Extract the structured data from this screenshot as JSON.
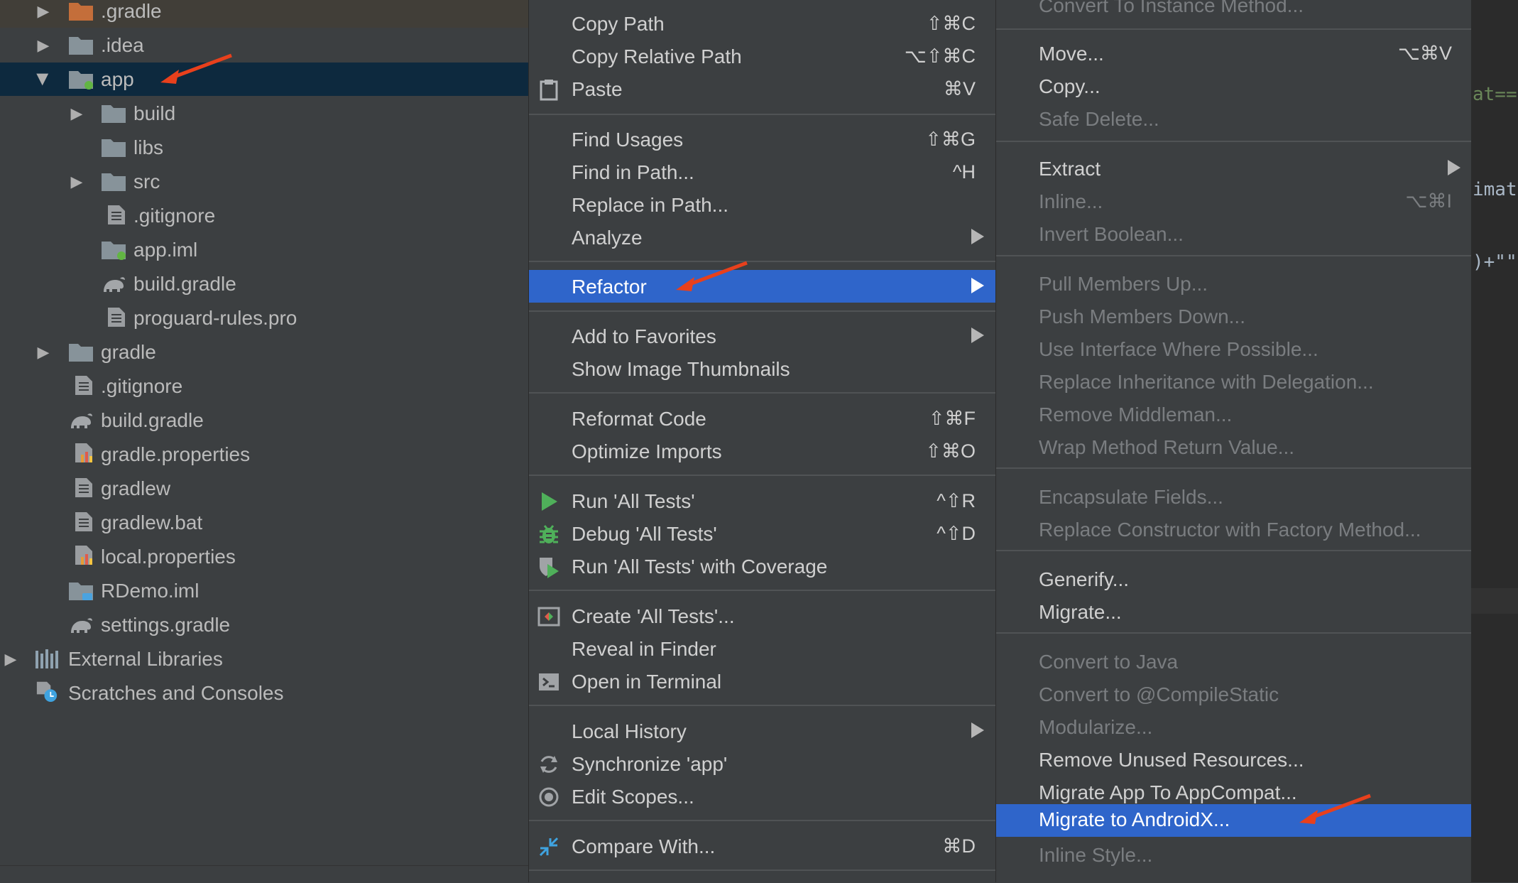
{
  "tree": {
    "items": [
      {
        "label": ".gradle",
        "icon": "folder-orange-icon",
        "arrow": "collapsed-arrow-icon"
      },
      {
        "label": ".idea",
        "icon": "folder-icon",
        "arrow": "collapsed-arrow-icon"
      },
      {
        "label": "app",
        "icon": "module-folder-icon",
        "arrow": "expanded-arrow-icon",
        "selected": true
      },
      {
        "label": "build",
        "icon": "folder-icon",
        "arrow": "collapsed-arrow-icon"
      },
      {
        "label": "libs",
        "icon": "folder-icon"
      },
      {
        "label": "src",
        "icon": "folder-icon",
        "arrow": "collapsed-arrow-icon"
      },
      {
        "label": ".gitignore",
        "icon": "text-file-icon"
      },
      {
        "label": "app.iml",
        "icon": "module-file-icon"
      },
      {
        "label": "build.gradle",
        "icon": "gradle-elephant-icon"
      },
      {
        "label": "proguard-rules.pro",
        "icon": "text-file-icon"
      },
      {
        "label": "gradle",
        "icon": "folder-icon",
        "arrow": "collapsed-arrow-icon"
      },
      {
        "label": ".gitignore",
        "icon": "text-file-icon"
      },
      {
        "label": "build.gradle",
        "icon": "gradle-elephant-icon"
      },
      {
        "label": "gradle.properties",
        "icon": "properties-file-icon"
      },
      {
        "label": "gradlew",
        "icon": "text-file-icon"
      },
      {
        "label": "gradlew.bat",
        "icon": "text-file-icon"
      },
      {
        "label": "local.properties",
        "icon": "properties-file-icon"
      },
      {
        "label": "RDemo.iml",
        "icon": "iml-module-icon"
      },
      {
        "label": "settings.gradle",
        "icon": "gradle-elephant-icon"
      },
      {
        "label": "External Libraries",
        "icon": "libraries-icon",
        "arrow": "collapsed-arrow-icon"
      },
      {
        "label": "Scratches and Consoles",
        "icon": "scratches-icon"
      }
    ]
  },
  "context_menu": {
    "items": [
      {
        "label": "Copy Path",
        "shortcut": "⇧⌘C"
      },
      {
        "label": "Copy Relative Path",
        "shortcut": "⌥⇧⌘C"
      },
      {
        "label": "Paste",
        "shortcut": "⌘V",
        "icon": "clipboard-icon"
      },
      {
        "label": "Find Usages",
        "shortcut": "⇧⌘G"
      },
      {
        "label": "Find in Path...",
        "shortcut": "^H"
      },
      {
        "label": "Replace in Path...",
        "shortcut": ""
      },
      {
        "label": "Analyze",
        "submenu": true
      },
      {
        "label": "Refactor",
        "submenu": true,
        "selected": true
      },
      {
        "label": "Add to Favorites",
        "submenu": true
      },
      {
        "label": "Show Image Thumbnails",
        "shortcut": ""
      },
      {
        "label": "Reformat Code",
        "shortcut": "⇧⌘F"
      },
      {
        "label": "Optimize Imports",
        "shortcut": "⇧⌘O"
      },
      {
        "label": "Run 'All Tests'",
        "shortcut": "^⇧R",
        "icon": "run-icon"
      },
      {
        "label": "Debug 'All Tests'",
        "shortcut": "^⇧D",
        "icon": "debug-bug-icon"
      },
      {
        "label": "Run 'All Tests' with Coverage",
        "shortcut": "",
        "icon": "coverage-icon"
      },
      {
        "label": "Create 'All Tests'...",
        "shortcut": "",
        "icon": "create-test-icon"
      },
      {
        "label": "Reveal in Finder",
        "shortcut": ""
      },
      {
        "label": "Open in Terminal",
        "shortcut": "",
        "icon": "terminal-icon"
      },
      {
        "label": "Local History",
        "submenu": true
      },
      {
        "label": "Synchronize 'app'",
        "shortcut": "",
        "icon": "synchronize-icon"
      },
      {
        "label": "Edit Scopes...",
        "shortcut": "",
        "icon": "scopes-icon"
      },
      {
        "label": "Compare With...",
        "shortcut": "⌘D",
        "icon": "compare-icon"
      }
    ]
  },
  "refactor_menu": {
    "items": [
      {
        "label": "Convert To Instance Method...",
        "disabled": true
      },
      {
        "label": "Move...",
        "shortcut": "⌥⌘V"
      },
      {
        "label": "Copy..."
      },
      {
        "label": "Safe Delete...",
        "disabled": true
      },
      {
        "label": "Extract",
        "submenu": true
      },
      {
        "label": "Inline...",
        "shortcut": "⌥⌘I",
        "disabled": true
      },
      {
        "label": "Invert Boolean...",
        "disabled": true
      },
      {
        "label": "Pull Members Up...",
        "disabled": true
      },
      {
        "label": "Push Members Down...",
        "disabled": true
      },
      {
        "label": "Use Interface Where Possible...",
        "disabled": true
      },
      {
        "label": "Replace Inheritance with Delegation...",
        "disabled": true
      },
      {
        "label": "Remove Middleman...",
        "disabled": true
      },
      {
        "label": "Wrap Method Return Value...",
        "disabled": true
      },
      {
        "label": "Encapsulate Fields...",
        "disabled": true
      },
      {
        "label": "Replace Constructor with Factory Method...",
        "disabled": true
      },
      {
        "label": "Generify..."
      },
      {
        "label": "Migrate..."
      },
      {
        "label": "Convert to Java",
        "disabled": true
      },
      {
        "label": "Convert to @CompileStatic",
        "disabled": true
      },
      {
        "label": "Modularize...",
        "disabled": true
      },
      {
        "label": "Remove Unused Resources..."
      },
      {
        "label": "Migrate App To AppCompat..."
      },
      {
        "label": "Migrate to AndroidX...",
        "selected": true
      },
      {
        "label": "Inline Style...",
        "disabled": true
      }
    ]
  },
  "editor": {
    "lines": [
      "at==",
      "imatc",
      ")+\"\"'"
    ],
    "colors": [
      "#6a8759",
      "#a9b7c6",
      "#a9b7c6"
    ]
  },
  "annotation_color": "#e8401c"
}
